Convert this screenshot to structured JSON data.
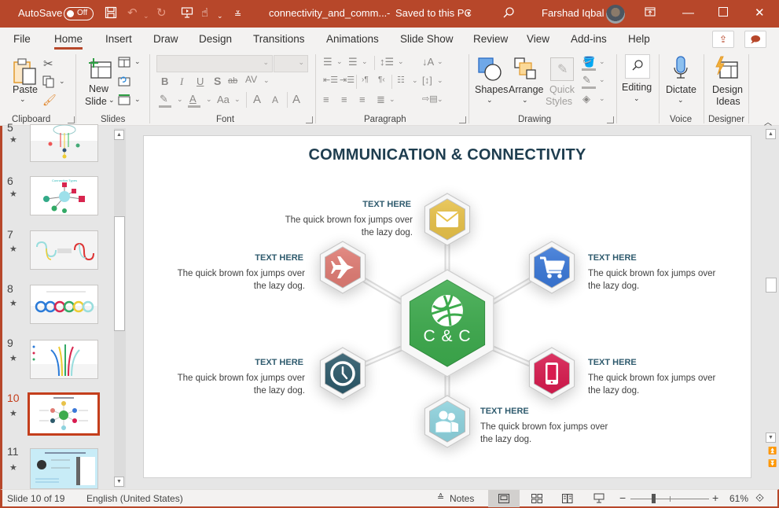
{
  "titlebar": {
    "autosave_label": "AutoSave",
    "autosave_state": "Off",
    "file_name": "connectivity_and_comm...",
    "separator": "-",
    "save_status": "Saved to this PC",
    "user_name": "Farshad Iqbal"
  },
  "tabs": [
    {
      "label": "File"
    },
    {
      "label": "Home"
    },
    {
      "label": "Insert"
    },
    {
      "label": "Draw"
    },
    {
      "label": "Design"
    },
    {
      "label": "Transitions"
    },
    {
      "label": "Animations"
    },
    {
      "label": "Slide Show"
    },
    {
      "label": "Review"
    },
    {
      "label": "View"
    },
    {
      "label": "Add-ins"
    },
    {
      "label": "Help"
    }
  ],
  "active_tab": "Home",
  "ribbon": {
    "clipboard": {
      "label": "Clipboard",
      "paste": "Paste"
    },
    "slides": {
      "label": "Slides",
      "new_slide_1": "New",
      "new_slide_2": "Slide"
    },
    "font": {
      "label": "Font",
      "font_name": "",
      "font_size": "",
      "bold": "B",
      "italic": "I",
      "underline": "U",
      "shadow": "S",
      "strike": "ab",
      "spacing": "AV",
      "case": "Aa",
      "grow": "A",
      "shrink": "A"
    },
    "paragraph": {
      "label": "Paragraph"
    },
    "drawing": {
      "label": "Drawing",
      "shapes": "Shapes",
      "arrange": "Arrange",
      "quick_styles_1": "Quick",
      "quick_styles_2": "Styles"
    },
    "editing": {
      "label": "Editing"
    },
    "voice": {
      "label": "Voice",
      "dictate": "Dictate"
    },
    "designer": {
      "label": "Designer",
      "design_ideas_1": "Design",
      "design_ideas_2": "Ideas"
    }
  },
  "slides_panel": {
    "items": [
      {
        "number": "5",
        "selected": false
      },
      {
        "number": "6",
        "selected": false
      },
      {
        "number": "7",
        "selected": false
      },
      {
        "number": "8",
        "selected": false
      },
      {
        "number": "9",
        "selected": false
      },
      {
        "number": "10",
        "selected": true
      },
      {
        "number": "11",
        "selected": false
      }
    ],
    "star": "★"
  },
  "slide": {
    "title": "COMMUNICATION & CONNECTIVITY",
    "center_label": "C & C",
    "nodes": [
      {
        "id": "top",
        "icon": "envelope-icon",
        "color": "#e8c24a",
        "caption": "TEXT HERE",
        "line1": "The quick brown fox jumps over",
        "line2": "the lazy dog."
      },
      {
        "id": "upper-left",
        "icon": "airplane-icon",
        "color": "#e07c74",
        "caption": "TEXT HERE",
        "line1": "The quick brown fox jumps over",
        "line2": "the lazy dog."
      },
      {
        "id": "upper-right",
        "icon": "shopping-cart-icon",
        "color": "#3a78d8",
        "caption": "TEXT HERE",
        "line1": "The quick brown fox jumps over",
        "line2": "the lazy dog."
      },
      {
        "id": "lower-left",
        "icon": "clock-icon",
        "color": "#2d5a6b",
        "caption": "TEXT HERE",
        "line1": "The quick brown fox jumps over",
        "line2": "the lazy dog."
      },
      {
        "id": "lower-right",
        "icon": "smartphone-icon",
        "color": "#d81b4f",
        "caption": "TEXT HERE",
        "line1": "The quick brown fox jumps over",
        "line2": "the lazy dog."
      },
      {
        "id": "bottom",
        "icon": "users-icon",
        "color": "#8fd3de",
        "caption": "TEXT HERE",
        "line1": "The quick brown fox jumps over",
        "line2": "the lazy dog."
      }
    ],
    "center_color": "#3dab4d"
  },
  "status": {
    "slide_indicator": "Slide 10 of 19",
    "language": "English (United States)",
    "notes": "Notes",
    "zoom_percent": "61%",
    "zoom_minus": "−",
    "zoom_plus": "+"
  },
  "colors": {
    "accent": "#b7472a",
    "title_text": "#1e3d4f",
    "caption_text": "#2f5b6e"
  }
}
